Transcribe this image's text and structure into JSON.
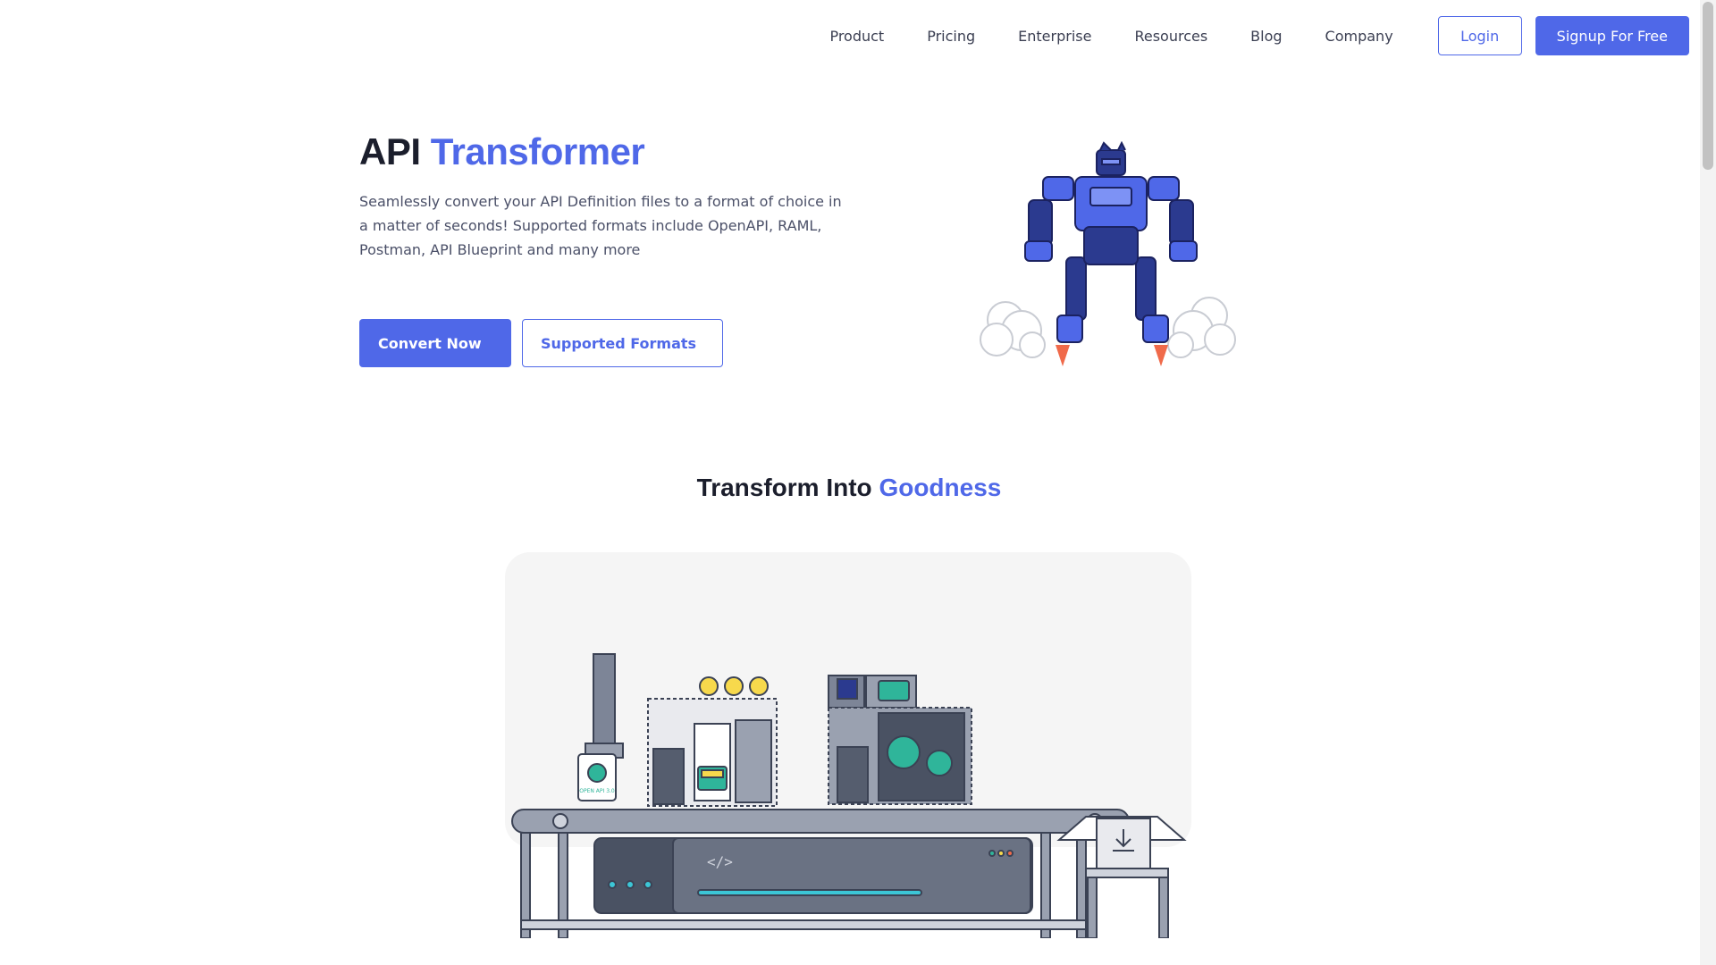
{
  "nav": {
    "links": [
      "Product",
      "Pricing",
      "Enterprise",
      "Resources",
      "Blog",
      "Company"
    ],
    "login_label": "Login",
    "signup_label": "Signup For Free"
  },
  "hero": {
    "title_plain": "API ",
    "title_accent": "Transformer",
    "description": "Seamlessly convert your API Definition files to a format of choice in a matter of seconds! Supported formats include OpenAPI, RAML, Postman, API Blueprint and many more",
    "primary_button": "Convert Now",
    "secondary_button": "Supported Formats"
  },
  "section": {
    "title_plain": "Transform Into ",
    "title_accent": "Goodness"
  },
  "illustration": {
    "doc_label": "OPEN API 3.0",
    "code_glyph": "</>"
  },
  "colors": {
    "accent": "#4f68e8",
    "text_dark": "#1b1e2c",
    "teal": "#2fb59a"
  }
}
